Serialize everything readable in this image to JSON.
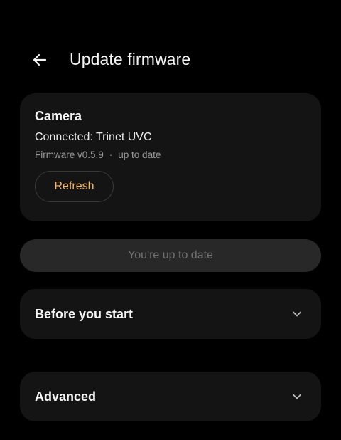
{
  "header": {
    "title": "Update firmware",
    "back_icon": "arrow-left-icon"
  },
  "camera": {
    "title": "Camera",
    "connected": "Connected: Trinet UVC",
    "firmware": "Firmware v0.5.9",
    "separator": "·",
    "status": "up to date",
    "refresh_label": "Refresh"
  },
  "update_button": {
    "label": "You're up to date"
  },
  "sections": {
    "before_start": "Before you start",
    "advanced": "Advanced"
  },
  "colors": {
    "background": "#000000",
    "card": "#141414",
    "accent": "#f3b567",
    "disabled_button": "#282828"
  }
}
